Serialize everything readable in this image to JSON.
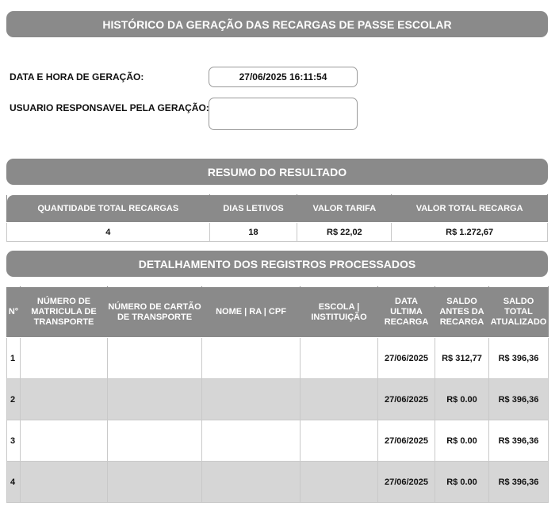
{
  "header": {
    "title": "HISTÓRICO DA GERAÇÃO DAS RECARGAS DE PASSE ESCOLAR"
  },
  "info": {
    "data_label": "DATA E HORA DE GERAÇÃO:",
    "data_value": "27/06/2025 16:11:54",
    "user_label": "USUARIO RESPONSAVEL PELA GERAÇÃO:",
    "user_value": ""
  },
  "resumo": {
    "title": "RESUMO DO RESULTADO",
    "headers": [
      "QUANTIDADE TOTAL RECARGAS",
      "DIAS LETIVOS",
      "VALOR TARIFA",
      "VALOR TOTAL RECARGA"
    ],
    "values": [
      "4",
      "18",
      "R$ 22,02",
      "R$ 1.272,67"
    ]
  },
  "detalhe": {
    "title": "DETALHAMENTO DOS REGISTROS PROCESSADOS",
    "headers": [
      "N°",
      "NÚMERO DE MATRICULA DE TRANSPORTE",
      "NÚMERO DE CARTÃO DE TRANSPORTE",
      "NOME | RA | CPF",
      "ESCOLA | INSTITUIÇÃO",
      "DATA ULTIMA RECARGA",
      "SALDO ANTES DA RECARGA",
      "SALDO TOTAL ATUALIZADO"
    ],
    "rows": [
      {
        "n": "1",
        "matricula": "",
        "cartao": "",
        "nome": "",
        "escola": "",
        "data": "27/06/2025",
        "saldo_antes": "R$ 312,77",
        "saldo_total": "R$ 396,36"
      },
      {
        "n": "2",
        "matricula": "",
        "cartao": "",
        "nome": "",
        "escola": "",
        "data": "27/06/2025",
        "saldo_antes": "R$ 0.00",
        "saldo_total": "R$ 396,36"
      },
      {
        "n": "3",
        "matricula": "",
        "cartao": "",
        "nome": "",
        "escola": "",
        "data": "27/06/2025",
        "saldo_antes": "R$ 0.00",
        "saldo_total": "R$ 396,36"
      },
      {
        "n": "4",
        "matricula": "",
        "cartao": "",
        "nome": "",
        "escola": "",
        "data": "27/06/2025",
        "saldo_antes": "R$ 0.00",
        "saldo_total": "R$ 396,36"
      }
    ]
  }
}
